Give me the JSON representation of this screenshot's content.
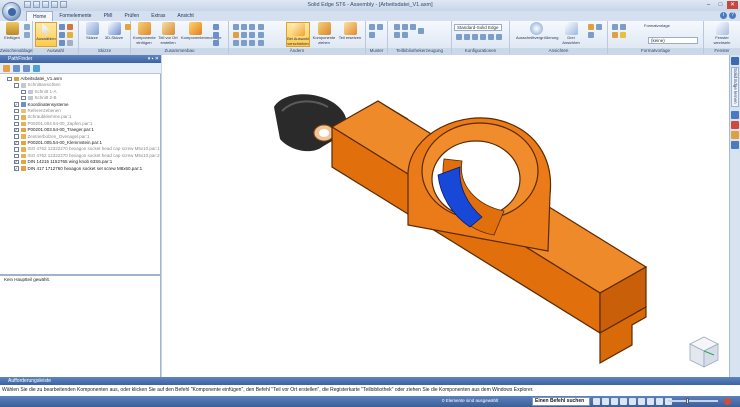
{
  "window": {
    "title": "Solid Edge ST6 - Assembly - [Arbeitsdatei_V1.asm]",
    "controls": [
      "–",
      "□",
      "✕"
    ]
  },
  "tabs": [
    "Home",
    "Formelemente",
    "PMI",
    "Prüfen",
    "Extras",
    "Ansicht"
  ],
  "active_tab": "Home",
  "ribbon": {
    "groups": [
      {
        "label": "Zwischenablage"
      },
      {
        "label": "Auswahl"
      },
      {
        "label": "Skizze"
      },
      {
        "label": "Zusammenbau"
      },
      {
        "label": "Ändern"
      },
      {
        "label": "Muster"
      },
      {
        "label": "Teilbibliothekerzeugung"
      },
      {
        "label": "Konfigurationen"
      },
      {
        "label": "Ansichten"
      },
      {
        "label": "Formatvorlage"
      },
      {
        "label": "Fenster"
      }
    ],
    "buttons": {
      "einfuegen": "Einfügen",
      "auswaehlen": "Auswählen",
      "skizze": "Skizze",
      "skizze3d": "3D-Skizze",
      "komponente": "Komponente einfügen",
      "teil_vor_ort": "Teil vor Ort erstellen",
      "komponentenmontage": "Komponentenmontage",
      "bei_auswahl": "Bei Auswahl verschieben",
      "komponente_ziehen": "Komponente ziehen",
      "teil_ersetzen": "Teil ersetzen",
      "muster": "Muster",
      "ausschnitt": "Ausschnittvergrößerung",
      "ansichten": "Drei Ansichten",
      "formatvorlage": "Formatvorlage",
      "fenster": "Fenster wechseln"
    },
    "config_combo": "Standard-Solid Edge",
    "style_combo": "(keine)"
  },
  "pathfinder": {
    "title": "PathFinder",
    "rows": [
      {
        "label": "Arbeitsdatei_V1.asm",
        "checked": false,
        "dim": false,
        "icon_color": "#d8a040",
        "indent": 0
      },
      {
        "label": "Schnittansichten",
        "checked": false,
        "dim": true,
        "icon_color": "#c0c8d6",
        "indent": 1
      },
      {
        "label": "Schnitt 1-A",
        "checked": false,
        "dim": true,
        "icon_color": "#c0c8d6",
        "indent": 2
      },
      {
        "label": "Schnitt 2-B",
        "checked": false,
        "dim": true,
        "icon_color": "#c0c8d6",
        "indent": 2
      },
      {
        "label": "Koordinatensysteme",
        "checked": true,
        "dim": false,
        "icon_color": "#6c8fd0",
        "indent": 1
      },
      {
        "label": "Referenzebenen",
        "checked": false,
        "dim": true,
        "icon_color": "#e0c080",
        "indent": 1
      },
      {
        "label": "Schraubklemme.par:1",
        "checked": false,
        "dim": true,
        "icon_color": "#e8b050",
        "indent": 1
      },
      {
        "label": "P00201.004.54-00_Zapfen.par:1",
        "checked": false,
        "dim": true,
        "icon_color": "#e8b050",
        "indent": 1
      },
      {
        "label": "P00201.003.54-00_Traeger.par:1",
        "checked": true,
        "dim": false,
        "icon_color": "#e8a040",
        "indent": 1
      },
      {
        "label": "Zentrierbolzen_Ovenagel.par:1",
        "checked": false,
        "dim": true,
        "icon_color": "#e8b050",
        "indent": 1
      },
      {
        "label": "P00201.005.54-00_Klemmstein.par:1",
        "checked": true,
        "dim": false,
        "icon_color": "#e8a040",
        "indent": 1
      },
      {
        "label": "ISO 4762 12322270 hexagon socket head cap screw M5x10.par:1",
        "checked": false,
        "dim": true,
        "icon_color": "#e8b050",
        "indent": 1
      },
      {
        "label": "ISO 4762 12322270 hexagon socket head cap screw M5x10.par:2",
        "checked": false,
        "dim": true,
        "icon_color": "#e8b050",
        "indent": 1
      },
      {
        "label": "DIN 14215 1152765 wing knob 63S6.par:1",
        "checked": true,
        "dim": false,
        "icon_color": "#e8a040",
        "indent": 1
      },
      {
        "label": "DIN 417 1712760 hexagon socket set screw M8x60.par:1",
        "checked": true,
        "dim": false,
        "icon_color": "#e8a040",
        "indent": 1
      }
    ],
    "status_text": "Kein Hauptteil gewählt."
  },
  "right_rail": {
    "tab_label": "Solid Edge lernen"
  },
  "prompt": {
    "title": "Aufforderungsleiste",
    "text": "Wählen Sie die zu bearbeitenden Komponenten aus, oder klicken Sie auf den Befehl \"Komponente einfügen\", den Befehl \"Teil vor Ort erstellen\", die Registerkarte \"Teilbibliothek\" oder ziehen Sie die Komponenten aus dem Windows Explorer."
  },
  "statusbar": {
    "element_count": "0 Elemente sind ausgewählt",
    "search_placeholder": "Einen Befehl suchen"
  },
  "colors": {
    "part_orange": "#e8720e",
    "part_blue": "#1848d8",
    "knob_dark": "#2a2a2a",
    "ribbon_accent": "#3c64a3"
  }
}
